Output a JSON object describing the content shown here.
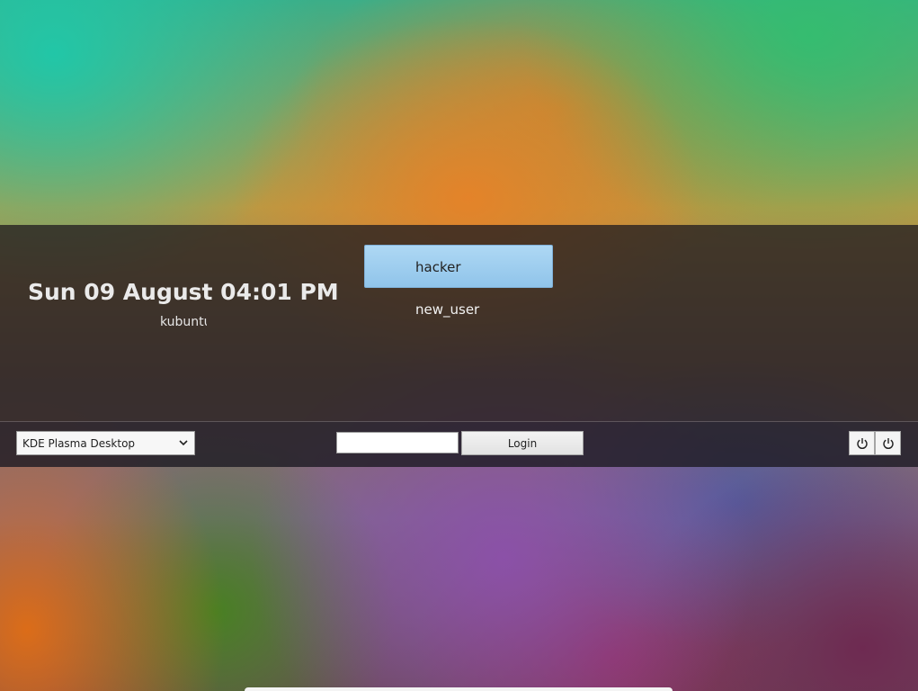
{
  "greeter": {
    "clock_text": "Sun 09 August 04:01 PM",
    "hostname": "kubuntu"
  },
  "users": [
    {
      "name": "hacker",
      "selected": true
    },
    {
      "name": "new_user",
      "selected": false
    }
  ],
  "session": {
    "selected": "KDE Plasma Desktop",
    "icon": "chevron-down-icon"
  },
  "login": {
    "password_value": "",
    "button_label": "Login"
  },
  "power": {
    "restart_icon": "restart-icon",
    "shutdown_icon": "power-icon"
  },
  "colors": {
    "selected_user_bg": "#9fcdef",
    "panel_bg": "#231e20"
  }
}
